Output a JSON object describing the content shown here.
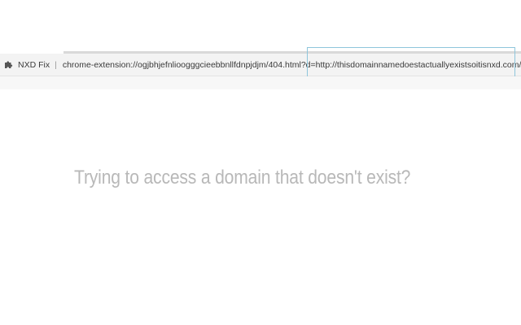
{
  "browser": {
    "extension_name": "NXD Fix",
    "extension_icon": "puzzle-piece-icon",
    "separator": "|",
    "url_prefix": "chrome-extension://ogjbhjefnlioogggcieebbnllfdnpjdjm/404.html?d=",
    "url_domain": "http://thisdomainnamedoestactuallyexistsoitisnxd.com/"
  },
  "main": {
    "message": "Trying to access a domain that doesn't exist?"
  }
}
